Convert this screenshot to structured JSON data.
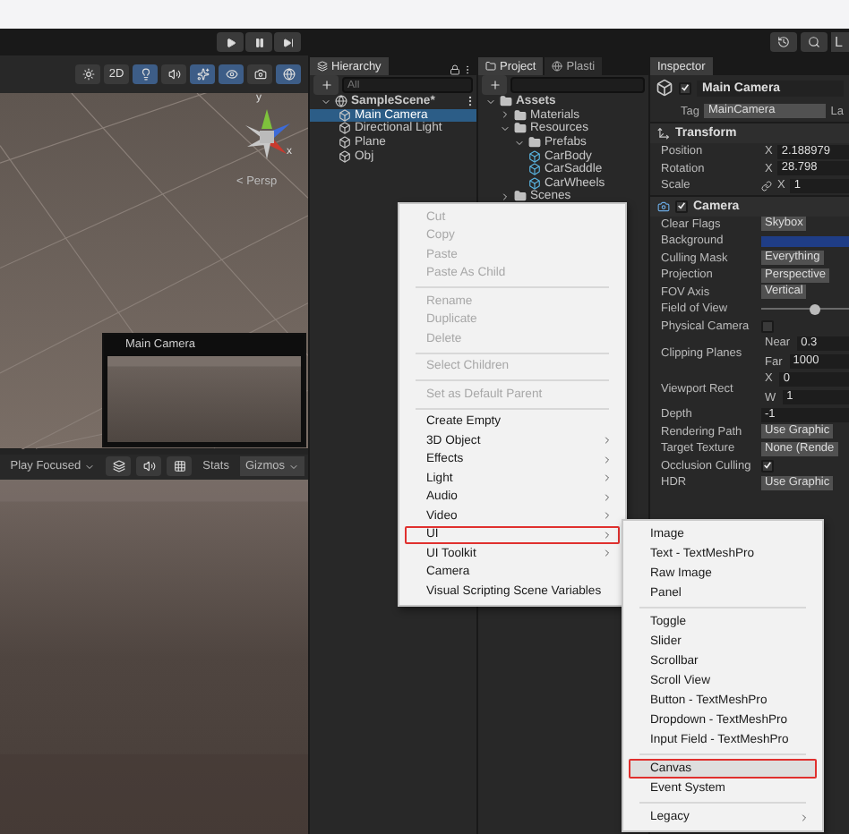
{
  "top_bar": {
    "account_label": "L"
  },
  "scene_view": {
    "mode_button": "2D",
    "projection_label": "< Persp",
    "axis_labels": [
      "y",
      "x"
    ],
    "camera_preview": {
      "title": "Main Camera"
    }
  },
  "game_view": {
    "play_mode": "Play Focused",
    "stats": "Stats",
    "gizmos": "Gizmos"
  },
  "hierarchy": {
    "title": "Hierarchy",
    "search": {
      "placeholder": "All"
    },
    "tree": [
      {
        "name": "SampleScene*",
        "kind": "scene",
        "selected": false,
        "children": [
          {
            "name": "Main Camera",
            "kind": "object",
            "selected": true
          },
          {
            "name": "Directional Light",
            "kind": "object",
            "selected": false
          },
          {
            "name": "Plane",
            "kind": "object",
            "selected": false
          },
          {
            "name": "Obj",
            "kind": "object",
            "selected": false
          }
        ]
      }
    ]
  },
  "project": {
    "tabs": [
      {
        "label": "Project",
        "selected": true
      },
      {
        "label": "Plasti",
        "selected": false
      }
    ],
    "tree": [
      {
        "name": "Assets",
        "kind": "folder",
        "expanded": true,
        "children": [
          {
            "name": "Materials",
            "kind": "folder",
            "expanded": false
          },
          {
            "name": "Resources",
            "kind": "folder",
            "expanded": true,
            "children": [
              {
                "name": "Prefabs",
                "kind": "folder",
                "expanded": true,
                "children": [
                  {
                    "name": "CarBody",
                    "kind": "prefab"
                  },
                  {
                    "name": "CarSaddle",
                    "kind": "prefab"
                  },
                  {
                    "name": "CarWheels",
                    "kind": "prefab"
                  }
                ]
              }
            ]
          },
          {
            "name": "Scenes",
            "kind": "folder",
            "expanded": false
          }
        ]
      }
    ]
  },
  "inspector": {
    "title": "Inspector",
    "object": {
      "name": "Main Camera",
      "active": true,
      "tag_label": "Tag",
      "tag": "MainCamera",
      "layer_label": "La"
    },
    "transform": {
      "title": "Transform",
      "rows": [
        {
          "label": "Position",
          "axis": "X",
          "value": "2.188979",
          "linked": false
        },
        {
          "label": "Rotation",
          "axis": "X",
          "value": "28.798",
          "linked": false
        },
        {
          "label": "Scale",
          "axis": "X",
          "value": "1",
          "linked": true
        }
      ]
    },
    "camera": {
      "title": "Camera",
      "enabled": true,
      "rows": [
        {
          "kind": "dropdown",
          "label": "Clear Flags",
          "value": "Skybox"
        },
        {
          "kind": "color",
          "label": "Background",
          "color": "#1f3d86"
        },
        {
          "kind": "dropdown",
          "label": "Culling Mask",
          "value": "Everything"
        },
        {
          "kind": "dropdown",
          "label": "Projection",
          "value": "Perspective"
        },
        {
          "kind": "dropdown",
          "label": "FOV Axis",
          "value": "Vertical"
        },
        {
          "kind": "slider",
          "label": "Field of View",
          "level": 0.62
        },
        {
          "kind": "checkbox",
          "label": "Physical Camera",
          "checked": false
        },
        {
          "kind": "pair",
          "label": "Clipping Planes",
          "fields": [
            {
              "label": "Near",
              "value": "0.3"
            },
            {
              "label": "Far",
              "value": "1000"
            }
          ]
        },
        {
          "kind": "pair",
          "label": "Viewport Rect",
          "fields": [
            {
              "label": "X",
              "value": "0"
            },
            {
              "label": "W",
              "value": "1"
            }
          ]
        },
        {
          "kind": "field",
          "label": "Depth",
          "value": "-1"
        },
        {
          "kind": "dropdown",
          "label": "Rendering Path",
          "value": "Use Graphic"
        },
        {
          "kind": "dropdown",
          "label": "Target Texture",
          "value": "None (Rende"
        },
        {
          "kind": "checkbox",
          "label": "Occlusion Culling",
          "checked": true
        },
        {
          "kind": "dropdown",
          "label": "HDR",
          "value": "Use Graphic"
        }
      ]
    }
  },
  "context_menu": {
    "items": [
      {
        "kind": "item",
        "label": "Cut",
        "disabled": true,
        "submenu": false,
        "highlighted": false
      },
      {
        "kind": "item",
        "label": "Copy",
        "disabled": true,
        "submenu": false,
        "highlighted": false
      },
      {
        "kind": "item",
        "label": "Paste",
        "disabled": true,
        "submenu": false,
        "highlighted": false
      },
      {
        "kind": "item",
        "label": "Paste As Child",
        "disabled": true,
        "submenu": false,
        "highlighted": false
      },
      {
        "kind": "divider"
      },
      {
        "kind": "item",
        "label": "Rename",
        "disabled": true,
        "submenu": false,
        "highlighted": false
      },
      {
        "kind": "item",
        "label": "Duplicate",
        "disabled": true,
        "submenu": false,
        "highlighted": false
      },
      {
        "kind": "item",
        "label": "Delete",
        "disabled": true,
        "submenu": false,
        "highlighted": false
      },
      {
        "kind": "divider"
      },
      {
        "kind": "item",
        "label": "Select Children",
        "disabled": true,
        "submenu": false,
        "highlighted": false
      },
      {
        "kind": "divider"
      },
      {
        "kind": "item",
        "label": "Set as Default Parent",
        "disabled": true,
        "submenu": false,
        "highlighted": false
      },
      {
        "kind": "divider"
      },
      {
        "kind": "item",
        "label": "Create Empty",
        "disabled": false,
        "submenu": false,
        "highlighted": false
      },
      {
        "kind": "item",
        "label": "3D Object",
        "disabled": false,
        "submenu": true,
        "highlighted": false
      },
      {
        "kind": "item",
        "label": "Effects",
        "disabled": false,
        "submenu": true,
        "highlighted": false
      },
      {
        "kind": "item",
        "label": "Light",
        "disabled": false,
        "submenu": true,
        "highlighted": false
      },
      {
        "kind": "item",
        "label": "Audio",
        "disabled": false,
        "submenu": true,
        "highlighted": false
      },
      {
        "kind": "item",
        "label": "Video",
        "disabled": false,
        "submenu": true,
        "highlighted": false
      },
      {
        "kind": "item",
        "label": "UI",
        "disabled": false,
        "submenu": true,
        "highlighted": true
      },
      {
        "kind": "item",
        "label": "UI Toolkit",
        "disabled": false,
        "submenu": true,
        "highlighted": false
      },
      {
        "kind": "item",
        "label": "Camera",
        "disabled": false,
        "submenu": false,
        "highlighted": false
      },
      {
        "kind": "item",
        "label": "Visual Scripting Scene Variables",
        "disabled": false,
        "submenu": false,
        "highlighted": false
      }
    ]
  },
  "ui_submenu": {
    "items": [
      {
        "kind": "item",
        "label": "Image",
        "submenu": false,
        "highlighted": false,
        "hovered": false
      },
      {
        "kind": "item",
        "label": "Text - TextMeshPro",
        "submenu": false,
        "highlighted": false,
        "hovered": false
      },
      {
        "kind": "item",
        "label": "Raw Image",
        "submenu": false,
        "highlighted": false,
        "hovered": false
      },
      {
        "kind": "item",
        "label": "Panel",
        "submenu": false,
        "highlighted": false,
        "hovered": false
      },
      {
        "kind": "divider"
      },
      {
        "kind": "item",
        "label": "Toggle",
        "submenu": false,
        "highlighted": false,
        "hovered": false
      },
      {
        "kind": "item",
        "label": "Slider",
        "submenu": false,
        "highlighted": false,
        "hovered": false
      },
      {
        "kind": "item",
        "label": "Scrollbar",
        "submenu": false,
        "highlighted": false,
        "hovered": false
      },
      {
        "kind": "item",
        "label": "Scroll View",
        "submenu": false,
        "highlighted": false,
        "hovered": false
      },
      {
        "kind": "item",
        "label": "Button - TextMeshPro",
        "submenu": false,
        "highlighted": false,
        "hovered": false
      },
      {
        "kind": "item",
        "label": "Dropdown - TextMeshPro",
        "submenu": false,
        "highlighted": false,
        "hovered": false
      },
      {
        "kind": "item",
        "label": "Input Field - TextMeshPro",
        "submenu": false,
        "highlighted": false,
        "hovered": false
      },
      {
        "kind": "divider"
      },
      {
        "kind": "item",
        "label": "Canvas",
        "submenu": false,
        "highlighted": true,
        "hovered": true
      },
      {
        "kind": "item",
        "label": "Event System",
        "submenu": false,
        "highlighted": false,
        "hovered": false
      },
      {
        "kind": "divider"
      },
      {
        "kind": "item",
        "label": "Legacy",
        "submenu": true,
        "highlighted": false,
        "hovered": false
      }
    ]
  }
}
